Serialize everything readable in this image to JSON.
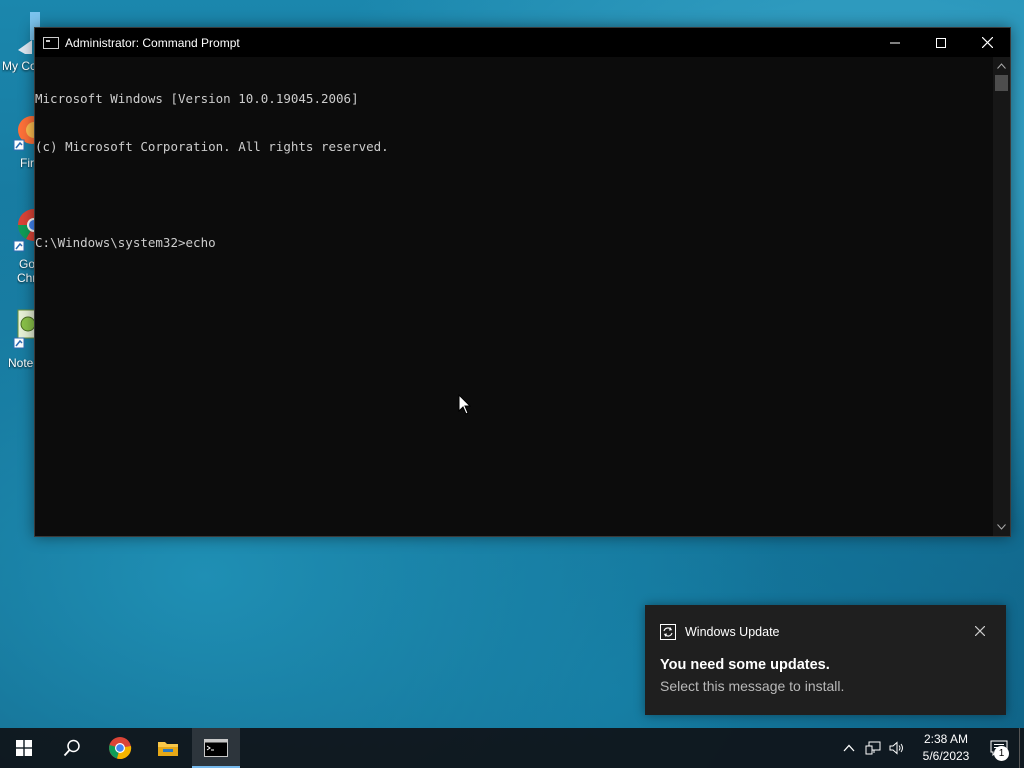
{
  "desktop": {
    "icons": [
      {
        "label": "My Co",
        "icon": "computer-icon"
      },
      {
        "label": "Fir",
        "icon": "firefox-icon"
      },
      {
        "label": "Go",
        "label2": "Chr",
        "icon": "chrome-icon"
      },
      {
        "label": "Note",
        "icon": "notepad-icon"
      }
    ]
  },
  "window": {
    "title": "Administrator: Command Prompt",
    "console_lines": [
      "Microsoft Windows [Version 10.0.19045.2006]",
      "(c) Microsoft Corporation. All rights reserved.",
      "",
      "C:\\Windows\\system32>echo"
    ]
  },
  "notification": {
    "app_name": "Windows Update",
    "title": "You need some updates.",
    "body": "Select this message to install."
  },
  "taskbar": {
    "pinned": [
      "start-button",
      "search-button",
      "chrome",
      "file-explorer",
      "command-prompt"
    ],
    "active": "command-prompt",
    "clock": {
      "time": "2:38 AM",
      "date": "5/6/2023"
    },
    "notification_count": "1"
  },
  "colors": {
    "console_bg": "#0c0c0c",
    "console_text": "#cccccc",
    "taskbar_accent": "#76b9ed"
  }
}
